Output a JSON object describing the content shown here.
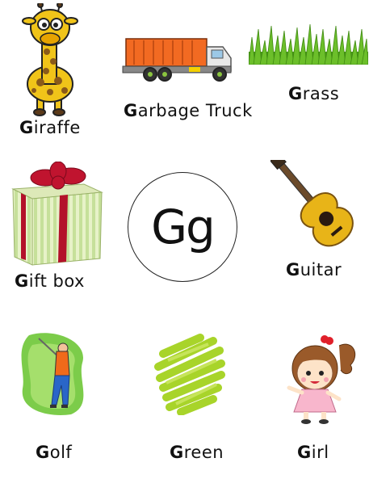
{
  "center_letters": "Gg",
  "items": [
    {
      "initial": "G",
      "rest": "iraffe"
    },
    {
      "initial": "G",
      "rest": "arbage Truck"
    },
    {
      "initial": "G",
      "rest": "rass"
    },
    {
      "initial": "G",
      "rest": "ift box"
    },
    {
      "initial": "G",
      "rest": "uitar"
    },
    {
      "initial": "G",
      "rest": "olf"
    },
    {
      "initial": "G",
      "rest": "reen"
    },
    {
      "initial": "G",
      "rest": "irl"
    }
  ],
  "icons": [
    "giraffe-icon",
    "garbage-truck-icon",
    "grass-icon",
    "gift-box-icon",
    "guitar-icon",
    "golf-icon",
    "green-scribble-icon",
    "girl-icon"
  ]
}
